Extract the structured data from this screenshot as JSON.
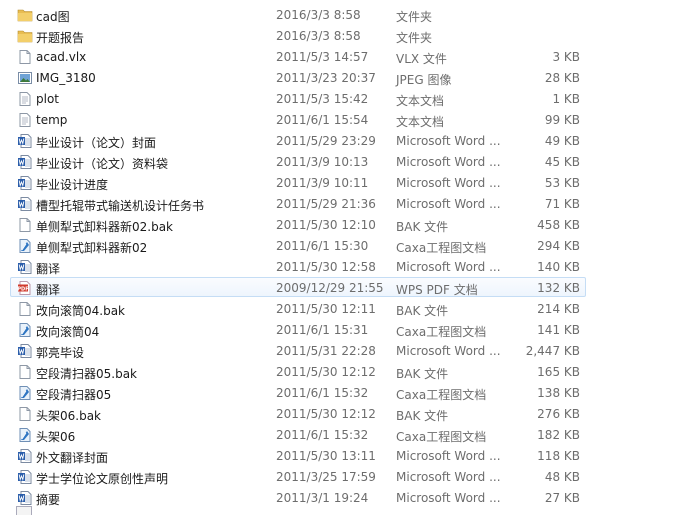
{
  "files": [
    {
      "name": "cad图",
      "date": "2016/3/3 8:58",
      "type": "文件夹",
      "size": "",
      "icon": "folder-icon"
    },
    {
      "name": "开题报告",
      "date": "2016/3/3 8:58",
      "type": "文件夹",
      "size": "",
      "icon": "folder-icon"
    },
    {
      "name": "acad.vlx",
      "date": "2011/5/3 14:57",
      "type": "VLX 文件",
      "size": "3 KB",
      "icon": "blank-file-icon"
    },
    {
      "name": "IMG_3180",
      "date": "2011/3/23 20:37",
      "type": "JPEG 图像",
      "size": "28 KB",
      "icon": "image-file-icon"
    },
    {
      "name": "plot",
      "date": "2011/5/3 15:42",
      "type": "文本文档",
      "size": "1 KB",
      "icon": "text-file-icon"
    },
    {
      "name": "temp",
      "date": "2011/6/1 15:54",
      "type": "文本文档",
      "size": "99 KB",
      "icon": "text-file-icon"
    },
    {
      "name": "毕业设计（论文）封面",
      "date": "2011/5/29 23:29",
      "type": "Microsoft Word ...",
      "size": "49 KB",
      "icon": "word-doc-icon"
    },
    {
      "name": "毕业设计（论文）资料袋",
      "date": "2011/3/9 10:13",
      "type": "Microsoft Word ...",
      "size": "45 KB",
      "icon": "word-doc-icon"
    },
    {
      "name": "毕业设计进度",
      "date": "2011/3/9 10:11",
      "type": "Microsoft Word ...",
      "size": "53 KB",
      "icon": "word-doc-icon"
    },
    {
      "name": "槽型托辊带式输送机设计任务书",
      "date": "2011/5/29 21:36",
      "type": "Microsoft Word ...",
      "size": "71 KB",
      "icon": "word-doc-icon"
    },
    {
      "name": "单侧犁式卸料器新02.bak",
      "date": "2011/5/30 12:10",
      "type": "BAK 文件",
      "size": "458 KB",
      "icon": "blank-file-icon"
    },
    {
      "name": "单侧犁式卸料器新02",
      "date": "2011/6/1 15:30",
      "type": "Caxa工程图文档",
      "size": "294 KB",
      "icon": "caxa-file-icon"
    },
    {
      "name": "翻译",
      "date": "2011/5/30 12:58",
      "type": "Microsoft Word ...",
      "size": "140 KB",
      "icon": "word-doc-icon"
    },
    {
      "name": "翻译",
      "date": "2009/12/29 21:55",
      "type": "WPS PDF 文档",
      "size": "132 KB",
      "icon": "pdf-file-icon"
    },
    {
      "name": "改向滚筒04.bak",
      "date": "2011/5/30 12:11",
      "type": "BAK 文件",
      "size": "214 KB",
      "icon": "blank-file-icon"
    },
    {
      "name": "改向滚筒04",
      "date": "2011/6/1 15:31",
      "type": "Caxa工程图文档",
      "size": "141 KB",
      "icon": "caxa-file-icon"
    },
    {
      "name": "郭亮毕设",
      "date": "2011/5/31 22:28",
      "type": "Microsoft Word ...",
      "size": "2,447 KB",
      "icon": "word-doc-icon"
    },
    {
      "name": "空段清扫器05.bak",
      "date": "2011/5/30 12:12",
      "type": "BAK 文件",
      "size": "165 KB",
      "icon": "blank-file-icon"
    },
    {
      "name": "空段清扫器05",
      "date": "2011/6/1 15:32",
      "type": "Caxa工程图文档",
      "size": "138 KB",
      "icon": "caxa-file-icon"
    },
    {
      "name": "头架06.bak",
      "date": "2011/5/30 12:12",
      "type": "BAK 文件",
      "size": "276 KB",
      "icon": "blank-file-icon"
    },
    {
      "name": "头架06",
      "date": "2011/6/1 15:32",
      "type": "Caxa工程图文档",
      "size": "182 KB",
      "icon": "caxa-file-icon"
    },
    {
      "name": "外文翻译封面",
      "date": "2011/5/30 13:11",
      "type": "Microsoft Word ...",
      "size": "118 KB",
      "icon": "word-doc-icon"
    },
    {
      "name": "学士学位论文原创性声明",
      "date": "2011/3/25 17:59",
      "type": "Microsoft Word ...",
      "size": "48 KB",
      "icon": "word-doc-icon"
    },
    {
      "name": "摘要",
      "date": "2011/3/1 19:24",
      "type": "Microsoft Word ...",
      "size": "27 KB",
      "icon": "word-doc-icon"
    }
  ],
  "hovered_row": 13,
  "colors": {
    "hover_border": "#c5ddf5",
    "folder": "#e8bd52",
    "word_blue": "#2a5daa",
    "pdf_red": "#d03a2c",
    "caxa_blue": "#2f76c3"
  }
}
